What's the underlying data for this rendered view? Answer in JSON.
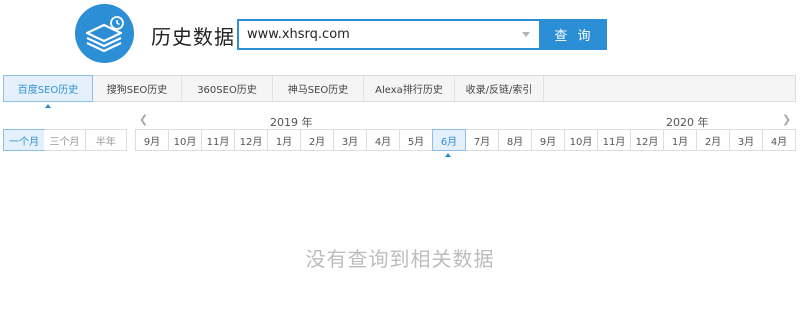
{
  "header": {
    "logo_icon": "stacked-layers-clock-icon",
    "title": "历史数据",
    "accent_color": "#2c8fd6"
  },
  "search": {
    "value": "www.xhsrq.com",
    "button_label": "查 询"
  },
  "tabs": [
    {
      "label": "百度SEO历史",
      "active": true
    },
    {
      "label": "搜狗SEO历史",
      "active": false
    },
    {
      "label": "360SEO历史",
      "active": false
    },
    {
      "label": "神马SEO历史",
      "active": false
    },
    {
      "label": "Alexa排行历史",
      "active": false
    },
    {
      "label": "收录/反链/索引",
      "active": false
    }
  ],
  "timeline": {
    "years": [
      "2019 年",
      "2020 年"
    ],
    "prev_icon": "chevron-left-icon",
    "next_icon": "chevron-right-icon",
    "ranges": [
      {
        "label": "一个月",
        "active": true
      },
      {
        "label": "三个月",
        "active": false
      },
      {
        "label": "半年",
        "active": false
      }
    ],
    "months": [
      {
        "label": "9月",
        "active": false
      },
      {
        "label": "10月",
        "active": false
      },
      {
        "label": "11月",
        "active": false
      },
      {
        "label": "12月",
        "active": false
      },
      {
        "label": "1月",
        "active": false
      },
      {
        "label": "2月",
        "active": false
      },
      {
        "label": "3月",
        "active": false
      },
      {
        "label": "4月",
        "active": false
      },
      {
        "label": "5月",
        "active": false
      },
      {
        "label": "6月",
        "active": true
      },
      {
        "label": "7月",
        "active": false
      },
      {
        "label": "8月",
        "active": false
      },
      {
        "label": "9月",
        "active": false
      },
      {
        "label": "10月",
        "active": false
      },
      {
        "label": "11月",
        "active": false
      },
      {
        "label": "12月",
        "active": false
      },
      {
        "label": "1月",
        "active": false
      },
      {
        "label": "2月",
        "active": false
      },
      {
        "label": "3月",
        "active": false
      },
      {
        "label": "4月",
        "active": false
      }
    ]
  },
  "empty_message": "没有查询到相关数据"
}
